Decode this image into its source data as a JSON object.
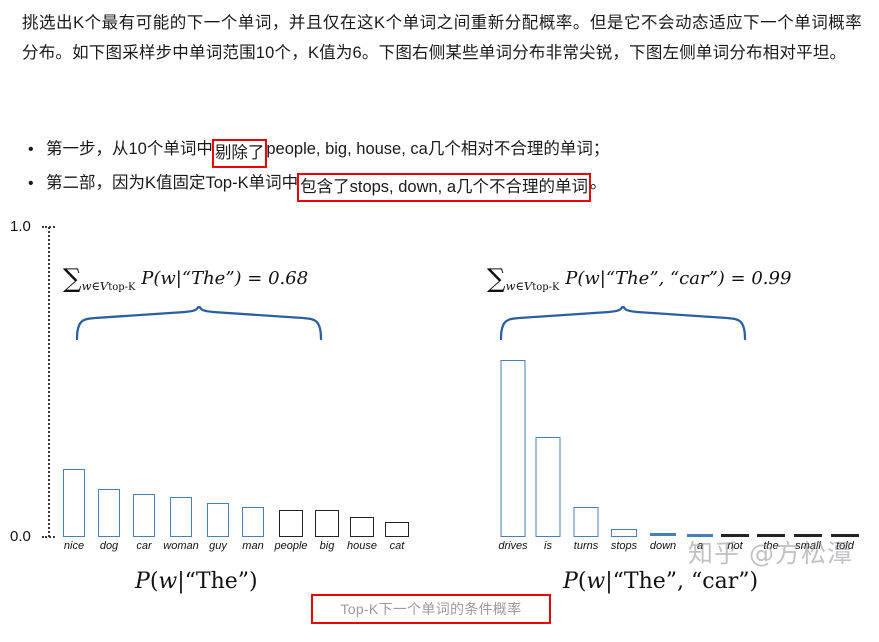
{
  "article": {
    "paragraph": "挑选出K个最有可能的下一个单词，并且仅在这K个单词之间重新分配概率。但是它不会动态适应下一个单词概率分布。如下图采样步中单词范围10个，K值为6。下图右侧某些单词分布非常尖锐，下图左侧单词分布相对平坦。",
    "bullets": [
      {
        "marker": "•",
        "pre": "第一步，从10个单词中",
        "highlight": "剔除了",
        "post": "people, big, house, ca几个相对不合理的单词；"
      },
      {
        "marker": "•",
        "pre": "第二部，因为K值固定Top-K单词中",
        "highlight": "包含了stops, down, a几个不合理的单词",
        "post": "。"
      }
    ]
  },
  "figure": {
    "caption": "Top-K下一个单词的条件概率",
    "watermark": "知乎 @方松潭",
    "y_axis": {
      "top_label": "1.0",
      "bottom_label": "0.0"
    },
    "colors": {
      "topk_bar": "#4a7ebb",
      "excluded_bar": "#232323",
      "highlight_red": "#ee0000",
      "caption_text": "#9b9b9b"
    }
  },
  "chart_data": [
    {
      "type": "bar",
      "title": "",
      "xlabel": "P(w|\"The\")",
      "ylabel": "",
      "ylim": [
        0.0,
        1.0
      ],
      "grid": false,
      "annotation": "∑ w∈V_top-K  P(w|“The”) = 0.68",
      "annotation_value": 0.68,
      "annotation_parts": {
        "sum": "∑",
        "subscript": "w∈V",
        "subscript_small": "top-K",
        "expr": "P(w|“The”) = 0.68"
      },
      "top_k": 6,
      "brace_label": "top-K region",
      "categories": [
        "nice",
        "dog",
        "car",
        "woman",
        "guy",
        "man",
        "people",
        "big",
        "house",
        "cat"
      ],
      "values": [
        0.216,
        0.152,
        0.136,
        0.126,
        0.106,
        0.094,
        0.086,
        0.086,
        0.064,
        0.048
      ],
      "in_top_k": [
        true,
        true,
        true,
        true,
        true,
        true,
        false,
        false,
        false,
        false
      ]
    },
    {
      "type": "bar",
      "title": "",
      "xlabel": "P(w|\"The\", \"car\")",
      "ylabel": "",
      "ylim": [
        0.0,
        1.0
      ],
      "grid": false,
      "annotation": "∑ w∈V_top-K  P(w|“The”, “car”) = 0.99",
      "annotation_value": 0.99,
      "annotation_parts": {
        "sum": "∑",
        "subscript": "w∈V",
        "subscript_small": "top-K",
        "expr": "P(w|“The”, “car”) = 0.99"
      },
      "top_k": 6,
      "brace_label": "top-K region",
      "categories": [
        "drives",
        "is",
        "turns",
        "stops",
        "down",
        "a",
        "not",
        "the",
        "small",
        "told"
      ],
      "values": [
        0.572,
        0.322,
        0.096,
        0.023,
        0.013,
        0.01,
        0.004,
        0.004,
        0.004,
        0.004
      ],
      "in_top_k": [
        true,
        true,
        true,
        true,
        true,
        true,
        false,
        false,
        false,
        false
      ]
    }
  ]
}
